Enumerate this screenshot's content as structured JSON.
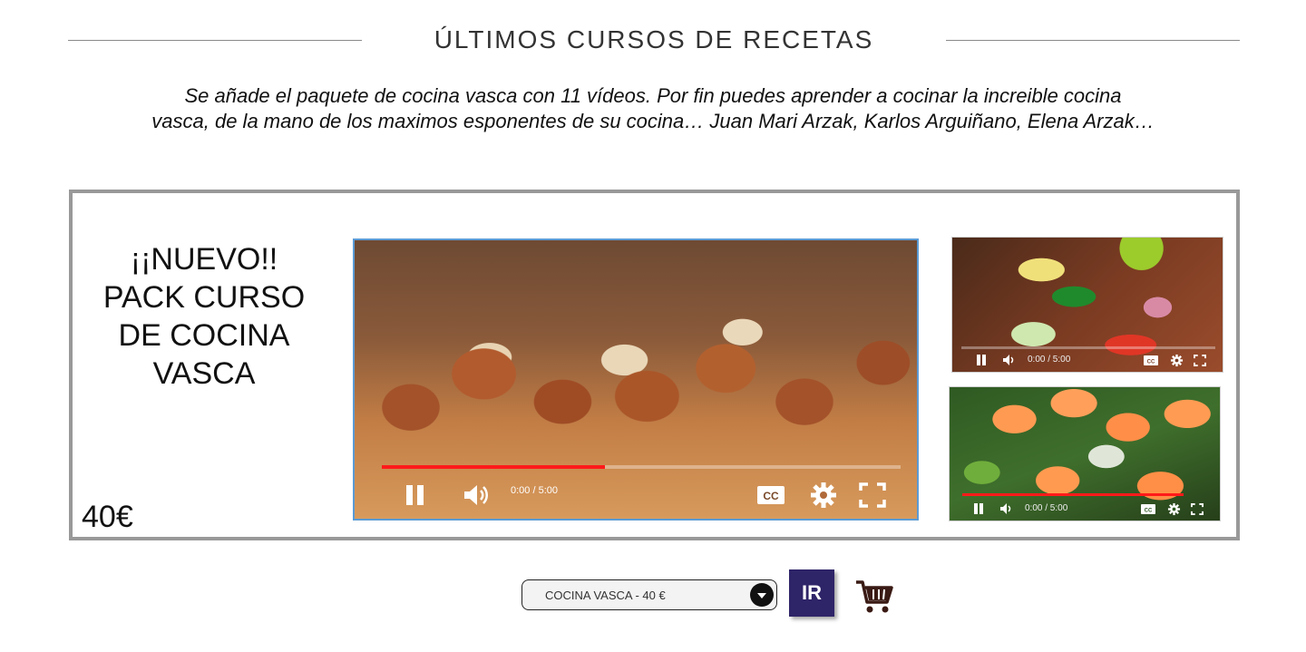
{
  "section": {
    "title": "ÚLTIMOS CURSOS DE RECETAS",
    "intro_line1": "Se añade el paquete de cocina vasca con 11 vídeos. Por fin puedes aprender a cocinar la increible cocina",
    "intro_line2": "vasca, de la mano de los maximos esponentes de su cocina… Juan Mari Arzak, Karlos Arguiñano, Elena Arzak…"
  },
  "promo": {
    "title_lines": [
      "¡¡NUEVO!!",
      "PACK CURSO",
      "DE COCINA",
      "VASCA"
    ],
    "price": "40€"
  },
  "videos": [
    {
      "id": "main",
      "time": "0:00 / 5:00",
      "progress": 0.43,
      "icons": [
        "pause-icon",
        "volume-icon",
        "closed-captions-icon",
        "settings-gear-icon",
        "fullscreen-icon"
      ]
    },
    {
      "id": "veggies",
      "time": "0:00 / 5:00",
      "progress": 0.0,
      "icons": [
        "pause-icon",
        "volume-icon",
        "closed-captions-icon",
        "settings-gear-icon",
        "fullscreen-icon"
      ]
    },
    {
      "id": "shrimp",
      "time": "0:00 / 5:00",
      "progress": 1.0,
      "icons": [
        "pause-icon",
        "volume-icon",
        "closed-captions-icon",
        "settings-gear-icon",
        "fullscreen-icon"
      ]
    }
  ],
  "order": {
    "selected_option": "COCINA VASCA - 40 €",
    "go_label": "IR",
    "cart_icon": "shopping-cart-icon"
  },
  "colors": {
    "frame_border": "#999999",
    "video_border": "#5b9bd5",
    "progress_red": "#ff1a1a",
    "button_bg": "#2e2468"
  }
}
